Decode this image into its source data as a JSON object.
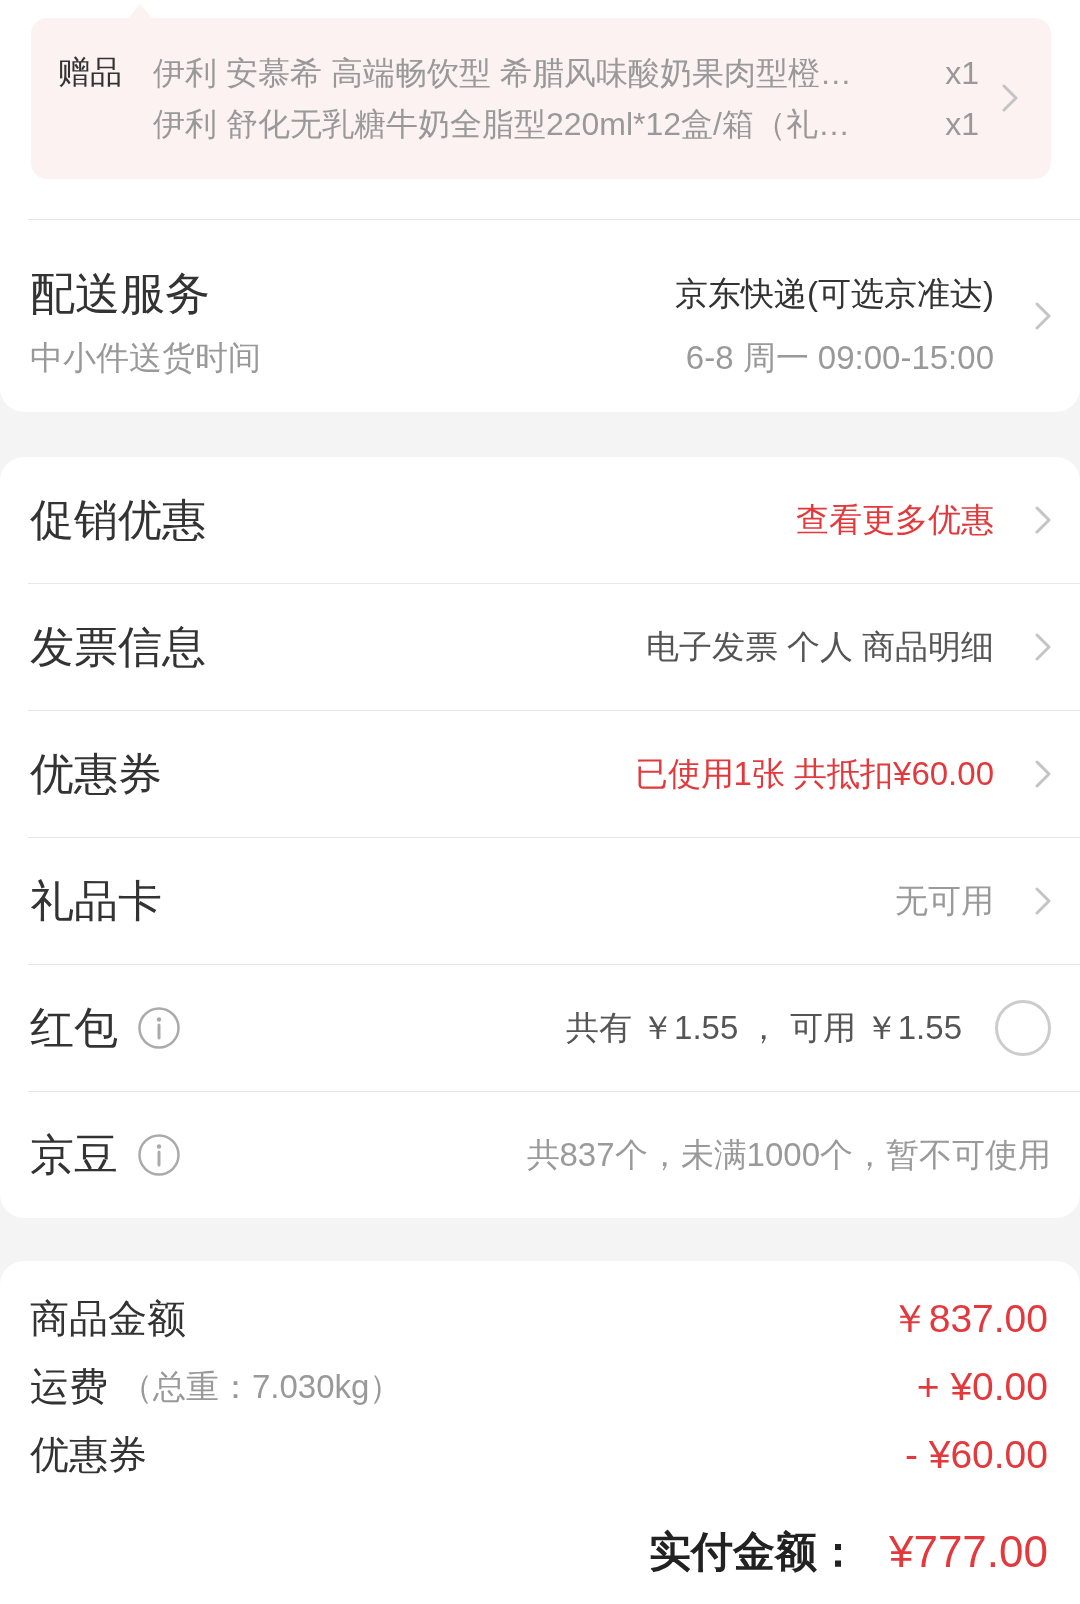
{
  "gifts": {
    "label": "赠品",
    "items": [
      {
        "name": "伊利 安慕希 高端畅饮型 希腊风味酸奶果肉型橙…",
        "quantity": "x1"
      },
      {
        "name": "伊利 舒化无乳糖牛奶全脂型220ml*12盒/箱（礼…",
        "quantity": "x1"
      }
    ]
  },
  "delivery": {
    "title": "配送服务",
    "subtitle": "中小件送货时间",
    "carrier": "京东快递(可选京准达)",
    "time": "6-8 周一 09:00-15:00"
  },
  "options": [
    {
      "kind": "link",
      "label": "促销优惠",
      "info": false,
      "value": "查看更多优惠",
      "highlighted": true,
      "disabled": false
    },
    {
      "kind": "link",
      "label": "发票信息",
      "info": false,
      "value": "电子发票 个人 商品明细",
      "highlighted": false,
      "disabled": false
    },
    {
      "kind": "link",
      "label": "优惠券",
      "info": false,
      "value": "已使用1张 共抵扣¥60.00",
      "highlighted": true,
      "disabled": false
    },
    {
      "kind": "link",
      "label": "礼品卡",
      "info": false,
      "value": "无可用",
      "highlighted": false,
      "disabled": true
    },
    {
      "kind": "toggle",
      "label": "红包",
      "info": true,
      "value": "共有 ￥1.55 ， 可用 ￥1.55",
      "highlighted": false,
      "disabled": false,
      "checked": false
    },
    {
      "kind": "text",
      "label": "京豆",
      "info": true,
      "value": "共837个，未满1000个，暂不可使用",
      "highlighted": false,
      "disabled": true
    }
  ],
  "summary": {
    "rows": [
      {
        "label": "商品金额",
        "amount": "￥837.00"
      },
      {
        "label": "运费",
        "note": "（总重：7.030kg）",
        "amount": "+ ¥0.00"
      },
      {
        "label": "优惠券",
        "amount": "- ¥60.00"
      }
    ],
    "total": {
      "label": "实付金额：",
      "amount": "¥777.00"
    }
  }
}
